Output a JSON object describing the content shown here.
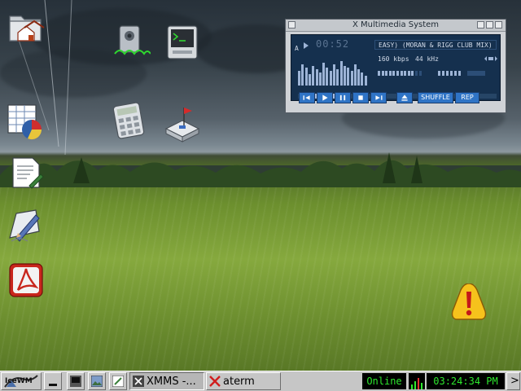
{
  "xmms": {
    "title": "X Multimedia System",
    "indicator": "A",
    "time": "00:52",
    "track": "EASY) (MORAN & RIGG CLUB MIX)",
    "bitrate": "160 kbps",
    "samplerate": "44 kHz",
    "shuffle_label": "SHUFFLE",
    "repeat_label": "REP"
  },
  "taskbar": {
    "start_label": "IceWM",
    "tasks": [
      {
        "label": "XMMS -..."
      },
      {
        "label": "aterm"
      }
    ],
    "status": "Online",
    "clock": "03:24:34 PM",
    "arrow": ">"
  },
  "icons": [
    "home-folder-icon",
    "sound-speaker-icon",
    "terminal-icon",
    "spreadsheet-chart-icon",
    "calculator-icon",
    "network-switch-icon",
    "text-editor-icon",
    "draw-tool-icon",
    "pdf-reader-icon",
    "warning-icon"
  ]
}
